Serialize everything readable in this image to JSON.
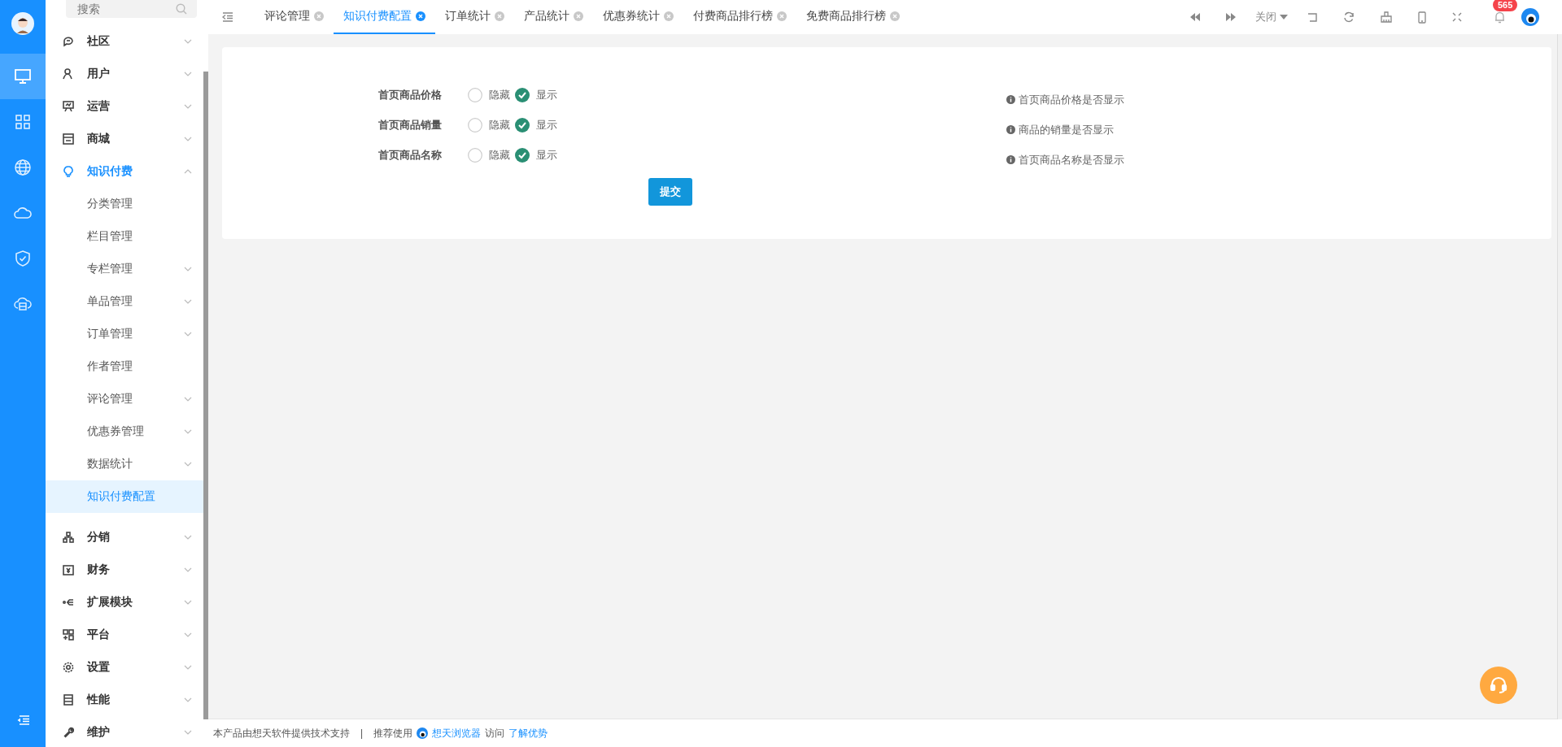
{
  "rail": {
    "items": [
      {
        "selected": false,
        "kind": "avatar"
      },
      {
        "selected": true,
        "kind": "monitor"
      },
      {
        "selected": false,
        "kind": "grid"
      },
      {
        "selected": false,
        "kind": "globe"
      },
      {
        "selected": false,
        "kind": "cloud"
      },
      {
        "selected": false,
        "kind": "shield"
      },
      {
        "selected": false,
        "kind": "cloud-box"
      }
    ]
  },
  "sidebar": {
    "search": {
      "placeholder": "搜索"
    },
    "items": [
      {
        "label": "社区",
        "expanded": false,
        "selected": false
      },
      {
        "label": "用户",
        "expanded": false,
        "selected": false
      },
      {
        "label": "运营",
        "expanded": false,
        "selected": false
      },
      {
        "label": "商城",
        "expanded": false,
        "selected": false
      },
      {
        "label": "知识付费",
        "expanded": true,
        "selected": true,
        "children": [
          {
            "label": "分类管理",
            "kind": "page",
            "selected": false
          },
          {
            "label": "栏目管理",
            "kind": "page",
            "selected": false
          },
          {
            "label": "专栏管理",
            "kind": "folder",
            "selected": false
          },
          {
            "label": "单品管理",
            "kind": "folder",
            "selected": false
          },
          {
            "label": "订单管理",
            "kind": "folder",
            "selected": false
          },
          {
            "label": "作者管理",
            "kind": "page",
            "selected": false
          },
          {
            "label": "评论管理",
            "kind": "folder",
            "selected": false
          },
          {
            "label": "优惠券管理",
            "kind": "folder",
            "selected": false
          },
          {
            "label": "数据统计",
            "kind": "folder",
            "selected": false
          },
          {
            "label": "知识付费配置",
            "kind": "page",
            "selected": true
          }
        ]
      },
      {
        "label": "分销",
        "expanded": false,
        "selected": false
      },
      {
        "label": "财务",
        "expanded": false,
        "selected": false
      },
      {
        "label": "扩展模块",
        "expanded": false,
        "selected": false
      },
      {
        "label": "平台",
        "expanded": false,
        "selected": false
      },
      {
        "label": "设置",
        "expanded": false,
        "selected": false
      },
      {
        "label": "性能",
        "expanded": false,
        "selected": false
      },
      {
        "label": "维护",
        "expanded": false,
        "selected": false
      }
    ]
  },
  "tabs": [
    {
      "label": "评论管理",
      "selected": false
    },
    {
      "label": "知识付费配置",
      "selected": true
    },
    {
      "label": "订单统计",
      "selected": false
    },
    {
      "label": "产品统计",
      "selected": false
    },
    {
      "label": "优惠券统计",
      "selected": false
    },
    {
      "label": "付费商品排行榜",
      "selected": false
    },
    {
      "label": "免费商品排行榜",
      "selected": false
    }
  ],
  "toolbar": {
    "close_menu": "关闭",
    "notification_count": "565"
  },
  "form": {
    "rows": [
      {
        "label": "首页商品价格",
        "options": [
          {
            "label": "隐藏",
            "selected": false
          },
          {
            "label": "显示",
            "selected": true
          }
        ],
        "hint": "首页商品价格是否显示"
      },
      {
        "label": "首页商品销量",
        "options": [
          {
            "label": "隐藏",
            "selected": false
          },
          {
            "label": "显示",
            "selected": true
          }
        ],
        "hint": "商品的销量是否显示"
      },
      {
        "label": "首页商品名称",
        "options": [
          {
            "label": "隐藏",
            "selected": false
          },
          {
            "label": "显示",
            "selected": true
          }
        ],
        "hint": "首页商品名称是否显示"
      }
    ],
    "submit": "提交"
  },
  "footer": {
    "credit": "本产品由想天软件提供技术支持",
    "separator": "|",
    "recommend": "推荐使用",
    "browser_link": "想天浏览器",
    "visit": "访问",
    "advantages_link": "了解优势"
  }
}
